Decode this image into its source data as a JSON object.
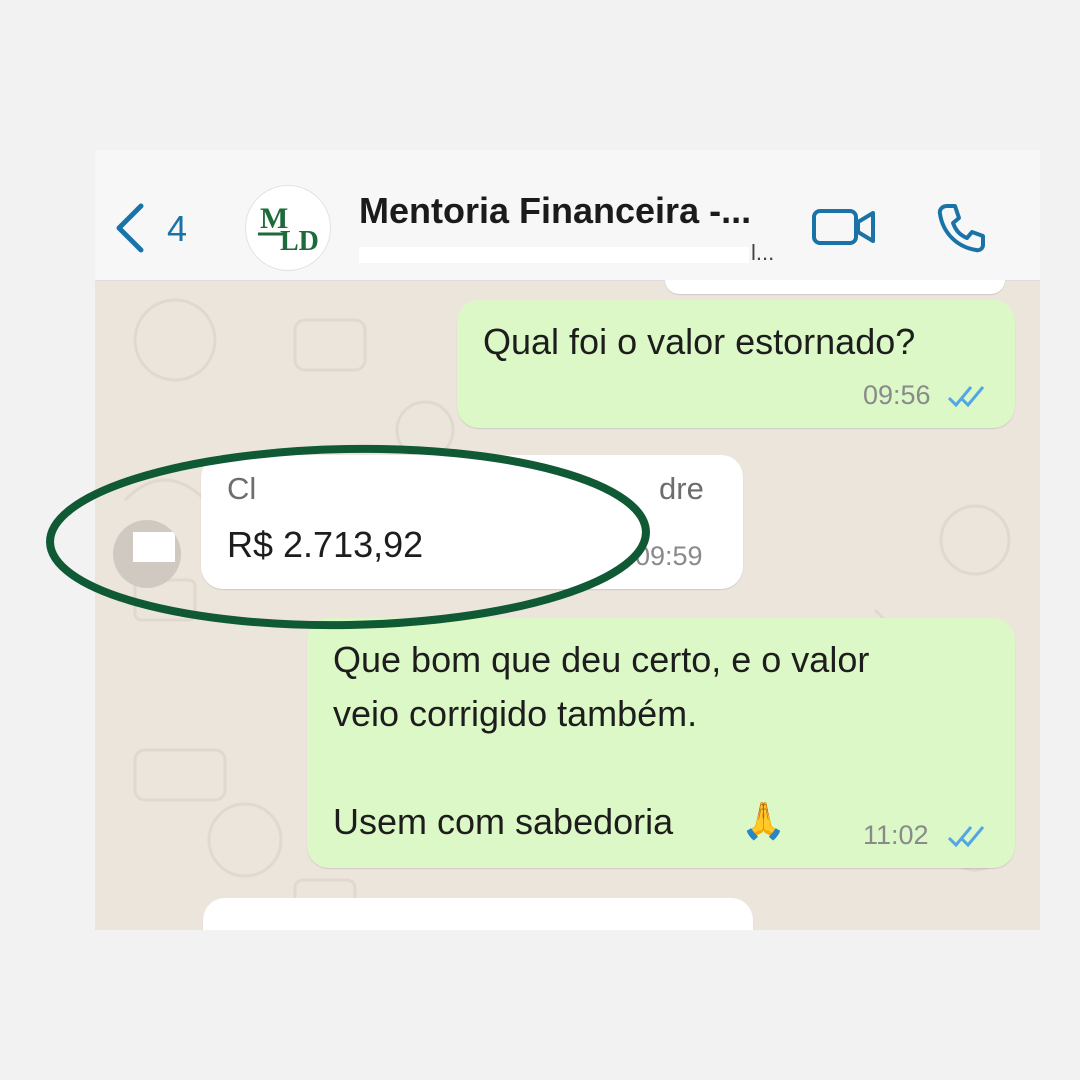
{
  "header": {
    "back_count": "4",
    "avatar_logo": "MLD",
    "title": "Mentoria Financeira -...",
    "subtitle_tail": "l...",
    "icons": {
      "back": "chevron-left-icon",
      "video": "video-call-icon",
      "phone": "phone-call-icon"
    }
  },
  "messages": [
    {
      "direction": "outgoing",
      "text": "Qual foi o valor estornado?",
      "time": "09:56",
      "status": "read"
    },
    {
      "direction": "incoming",
      "sender_visible_start": "Cl",
      "sender_visible_end": "dre",
      "text": "R$ 2.713,92",
      "time": "09:59"
    },
    {
      "direction": "outgoing",
      "line1": "Que bom que deu certo, e o valor",
      "line2": "veio corrigido também.",
      "line3": "Usem com sabedoria",
      "emoji": "🙏",
      "time": "11:02",
      "status": "read"
    }
  ],
  "colors": {
    "accent_blue": "#1a73a8",
    "outgoing_bubble": "#dcf8c6",
    "incoming_bubble": "#ffffff",
    "highlight_ellipse": "#0f5a35",
    "logo_green": "#1d6b3a"
  }
}
